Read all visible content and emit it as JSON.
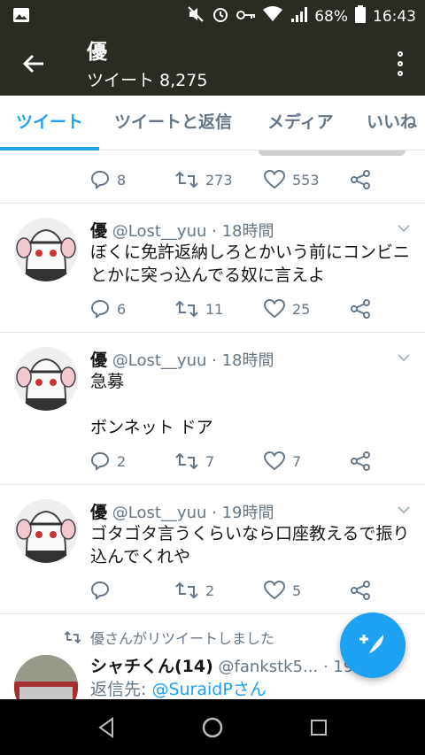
{
  "status_bar": {
    "battery": "68%",
    "time": "16:43"
  },
  "app_bar": {
    "title": "優",
    "subtitle": "ツイート 8,275"
  },
  "tabs": [
    {
      "label": "ツイート",
      "active": true
    },
    {
      "label": "ツイートと返信",
      "active": false
    },
    {
      "label": "メディア",
      "active": false
    },
    {
      "label": "いいね",
      "active": false
    }
  ],
  "tweets": [
    {
      "partial": true,
      "replies": "8",
      "retweets": "273",
      "likes": "553"
    },
    {
      "name": "優",
      "handle": "@Lost__yuu",
      "time": "· 18時間",
      "text": "ぼくに免許返納しろとかいう前にコンビニとかに突っ込んでる奴に言えよ",
      "replies": "6",
      "retweets": "11",
      "likes": "25"
    },
    {
      "name": "優",
      "handle": "@Lost__yuu",
      "time": "· 18時間",
      "text": "急募\n\nボンネット ドア",
      "replies": "2",
      "retweets": "7",
      "likes": "7"
    },
    {
      "name": "優",
      "handle": "@Lost__yuu",
      "time": "· 19時間",
      "text": "ゴタゴタ言うくらいなら口座教えるで振り込んでくれや",
      "replies": "",
      "retweets": "2",
      "likes": "5"
    },
    {
      "retweet_context": "優さんがリツイートしました",
      "name": "シャチくん(14)",
      "handle": "@fankstk5...",
      "time": "· 19",
      "reply_prefix": "返信先: ",
      "reply_to": "@SuraidPさん"
    }
  ],
  "colors": {
    "accent": "#1da1f2",
    "bar": "#2b2a23",
    "like": "#e0245e"
  },
  "icons": {
    "back": "arrow-left-icon",
    "menu": "more-vertical-icon",
    "reply": "reply-icon",
    "retweet": "retweet-icon",
    "like": "heart-icon",
    "share": "share-icon",
    "compose": "compose-tweet-icon"
  }
}
